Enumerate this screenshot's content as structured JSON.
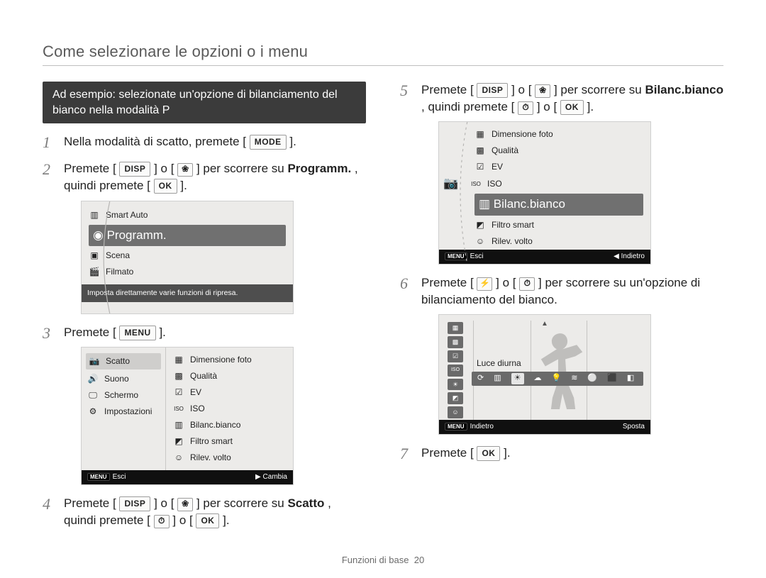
{
  "page_title": "Come selezionare le opzioni o i menu",
  "example_bar": "Ad esempio: selezionate un'opzione di bilanciamento del bianco nella modalità P",
  "buttons": {
    "mode": "MODE",
    "disp": "DISP",
    "macro": "❀",
    "ok": "OK",
    "menu": "MENU",
    "flash": "⚡",
    "timer": "⏱",
    "menu_key": "MENU",
    "left_tri": "◀",
    "right_tri": "▶",
    "esci": "Esci",
    "cambia": "Cambia",
    "indietro": "Indietro",
    "sposta": "Sposta"
  },
  "steps_left": {
    "s1": {
      "a": "Nella modalità di scatto, premete [",
      "b": "]."
    },
    "s2": {
      "a": "Premete [",
      "b": "] o [",
      "c": "] per scorrere su ",
      "d": "Programm.",
      "e": ", quindi premete [",
      "f": "]."
    },
    "s3": {
      "a": "Premete [",
      "b": "]."
    },
    "s4": {
      "a": "Premete [",
      "b": "] o [",
      "c": "] per scorrere su ",
      "d": "Scatto",
      "e": ", quindi premete [",
      "f": "] o [",
      "g": "]."
    }
  },
  "steps_right": {
    "s5": {
      "a": "Premete [",
      "b": "] o [",
      "c": "] per scorrere su ",
      "d": "Bilanc.bianco",
      "e": ", quindi premete [",
      "f": "] o [",
      "g": "]."
    },
    "s6": {
      "a": "Premete [",
      "b": "] o [",
      "c": "] per scorrere su un'opzione di bilanciamento del bianco."
    },
    "s7": {
      "a": "Premete [",
      "b": "]."
    }
  },
  "lcd_modes": {
    "items": [
      {
        "icon": "▥",
        "label": "Smart Auto",
        "selected": false
      },
      {
        "icon": "◉",
        "label": "Programm.",
        "selected": true
      },
      {
        "icon": "▣",
        "label": "Scena",
        "selected": false
      },
      {
        "icon": "🎬",
        "label": "Filmato",
        "selected": false
      }
    ],
    "tip": "Imposta direttamente varie funzioni di ripresa."
  },
  "lcd_menu": {
    "left": [
      {
        "icon": "📷",
        "label": "Scatto",
        "selected": true
      },
      {
        "icon": "🔊",
        "label": "Suono",
        "selected": false
      },
      {
        "icon": "🖵",
        "label": "Schermo",
        "selected": false
      },
      {
        "icon": "⚙",
        "label": "Impostazioni",
        "selected": false
      }
    ],
    "right": [
      {
        "icon": "▦",
        "label": "Dimensione foto"
      },
      {
        "icon": "▩",
        "label": "Qualità"
      },
      {
        "icon": "☑",
        "label": "EV"
      },
      {
        "icon": "ISO",
        "label": "ISO"
      },
      {
        "icon": "▥",
        "label": "Bilanc.bianco"
      },
      {
        "icon": "◩",
        "label": "Filtro smart"
      },
      {
        "icon": "☺",
        "label": "Rilev. volto"
      }
    ],
    "footer_left": "Esci",
    "footer_right": "Cambia"
  },
  "lcd_wb_menu": {
    "items": [
      {
        "icon": "▦",
        "label": "Dimensione foto",
        "selected": false
      },
      {
        "icon": "▩",
        "label": "Qualità",
        "selected": false
      },
      {
        "icon": "☑",
        "label": "EV",
        "selected": false
      },
      {
        "icon": "ISO",
        "label": "ISO",
        "selected": false
      },
      {
        "icon": "▥",
        "label": "Bilanc.bianco",
        "selected": true
      },
      {
        "icon": "◩",
        "label": "Filtro smart",
        "selected": false
      },
      {
        "icon": "☺",
        "label": "Rilev. volto",
        "selected": false
      }
    ],
    "icon_left": "📷",
    "footer_left": "Esci",
    "footer_right": "Indietro"
  },
  "lcd_wb_select": {
    "label": "Luce diurna",
    "side_icons": [
      "▦",
      "▩",
      "☑",
      "ISO",
      "☀",
      "◩",
      "☺"
    ],
    "strip": [
      "⟳",
      "▥",
      "☀",
      "☁",
      "💡",
      "≋",
      "⚪",
      "⬛",
      "◧"
    ],
    "selected_index": 2,
    "footer_left": "Indietro",
    "footer_right": "Sposta"
  },
  "footer": {
    "section": "Funzioni di base",
    "page": "20"
  }
}
